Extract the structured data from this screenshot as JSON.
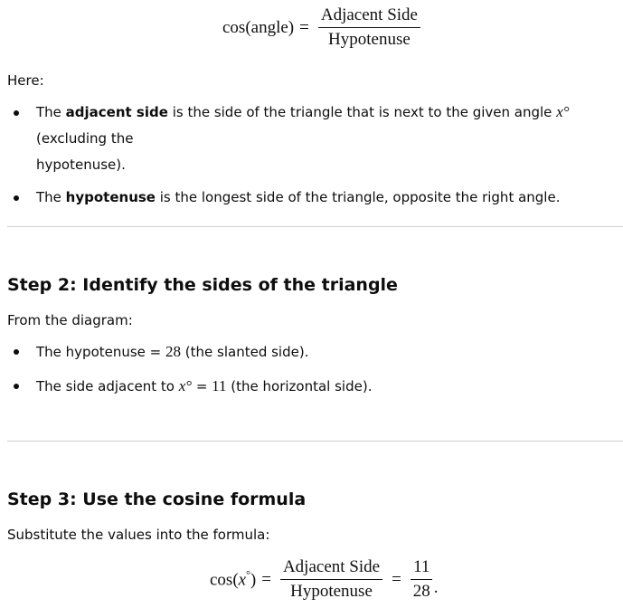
{
  "formula1": {
    "lhs": "cos(angle)",
    "equals": "=",
    "numerator": "Adjacent Side",
    "denominator": "Hypotenuse"
  },
  "here_label": "Here:",
  "definitions": [
    {
      "pre": "The ",
      "bold": "adjacent side",
      "mid": " is the side of the triangle that is next to the given angle ",
      "math": "x°",
      "post": " (excluding the",
      "wrap": "hypotenuse)."
    },
    {
      "pre": "The ",
      "bold": "hypotenuse",
      "post": " is the longest side of the triangle, opposite the right angle."
    }
  ],
  "step2": {
    "heading": "Step 2: Identify the sides of the triangle",
    "intro": "From the diagram:",
    "items": [
      {
        "pre": "The hypotenuse = ",
        "math": "28",
        "post": " (the slanted side)."
      },
      {
        "pre": "The side adjacent to ",
        "math": "x°",
        "mid": " = ",
        "math2": "11",
        "post": " (the horizontal side)."
      }
    ]
  },
  "step3": {
    "heading": "Step 3: Use the cosine formula",
    "intro": "Substitute the values into the formula:",
    "formula": {
      "lhs_fn": "cos(",
      "lhs_var": "x",
      "lhs_deg": "°",
      "lhs_close": ")",
      "equals": "=",
      "numerator": "Adjacent Side",
      "denominator": "Hypotenuse",
      "equals2": "=",
      "value_num": "11",
      "value_den": "28",
      "terminator": "."
    }
  }
}
